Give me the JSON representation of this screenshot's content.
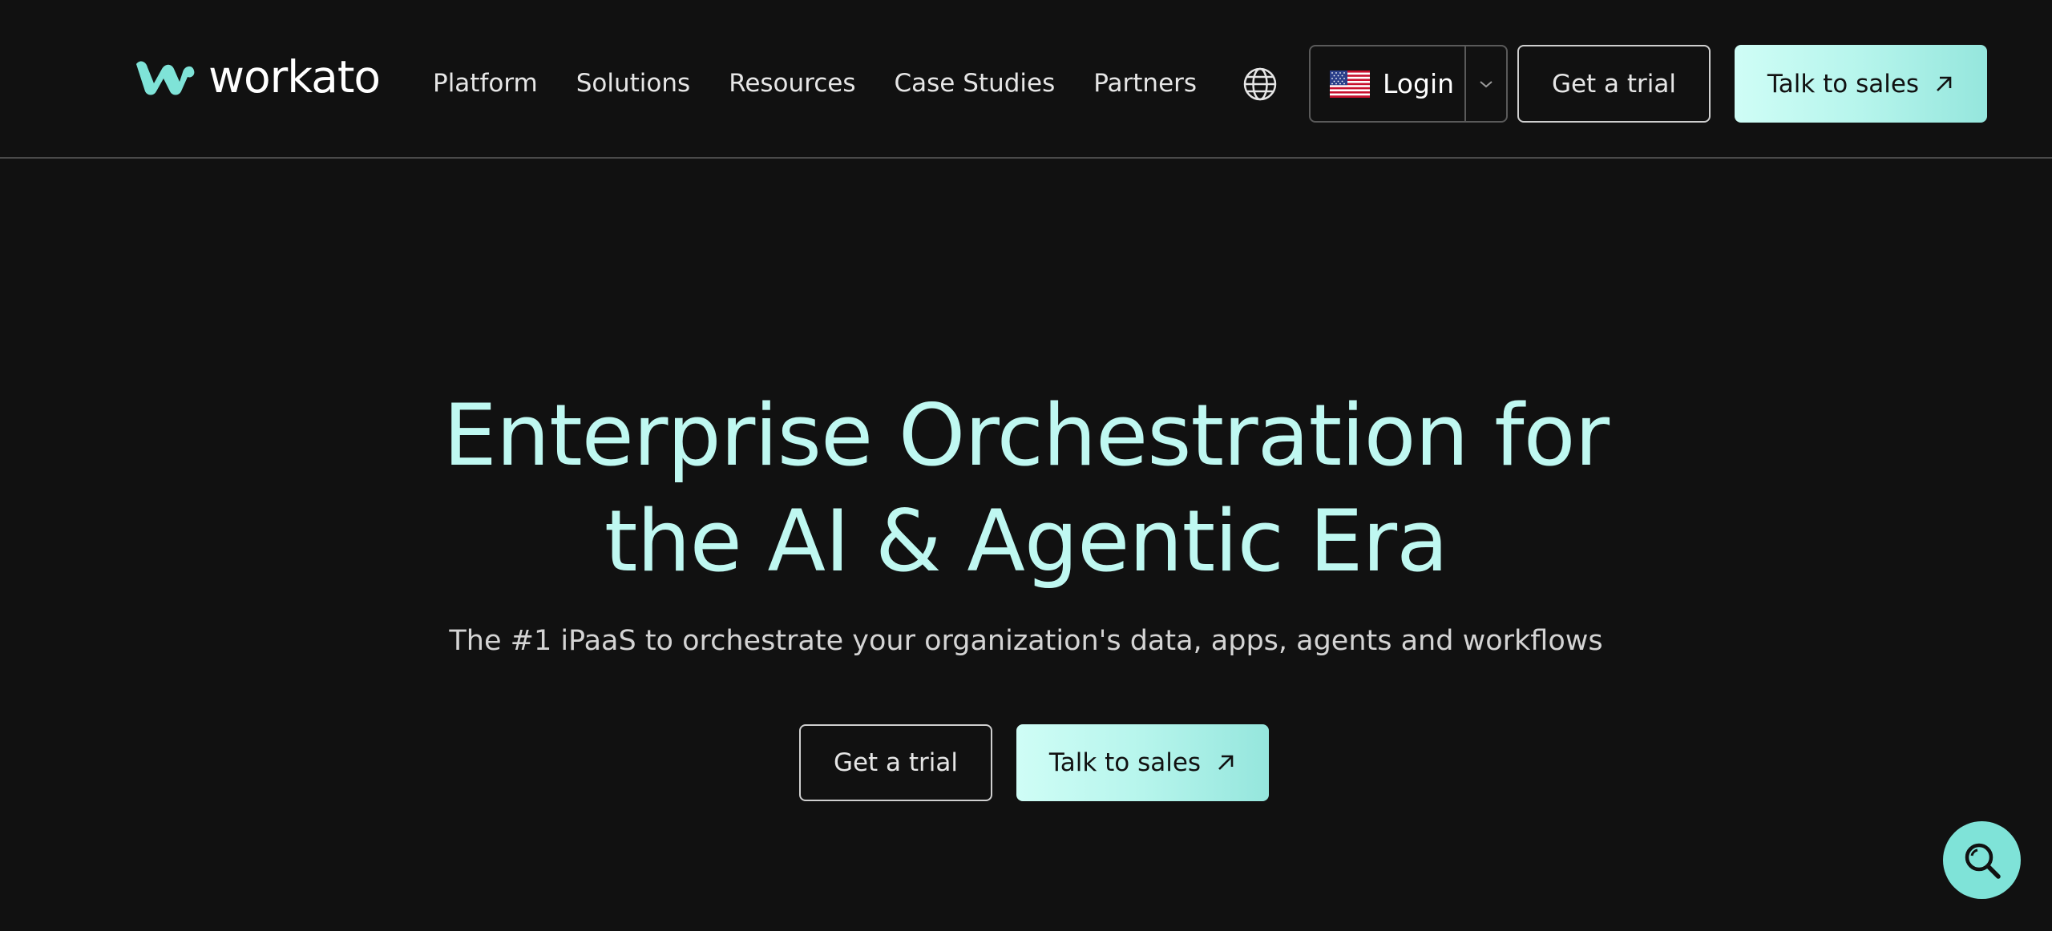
{
  "header": {
    "logo": {
      "text": "workato",
      "icon": "workato-logo-icon",
      "brand_color": "#7fe3d8"
    },
    "nav": [
      {
        "label": "Platform"
      },
      {
        "label": "Solutions"
      },
      {
        "label": "Resources"
      },
      {
        "label": "Case Studies"
      },
      {
        "label": "Partners"
      }
    ],
    "language_icon": "globe-icon",
    "login": {
      "label": "Login",
      "flag_icon": "us-flag-icon",
      "caret_icon": "chevron-down-icon"
    },
    "trial_label": "Get a trial",
    "sales_label": "Talk to sales"
  },
  "hero": {
    "title_line1": "Enterprise Orchestration for",
    "title_line2": "the AI & Agentic Era",
    "subtitle": "The #1 iPaaS to orchestrate your organization's data, apps, agents and workflows",
    "trial_label": "Get a trial",
    "sales_label": "Talk to sales"
  },
  "floating_button": {
    "icon": "search-icon"
  },
  "colors": {
    "background": "#111111",
    "accent": "#bff8f1",
    "cta_gradient_start": "#cffdf6",
    "cta_gradient_end": "#95e6dd"
  }
}
